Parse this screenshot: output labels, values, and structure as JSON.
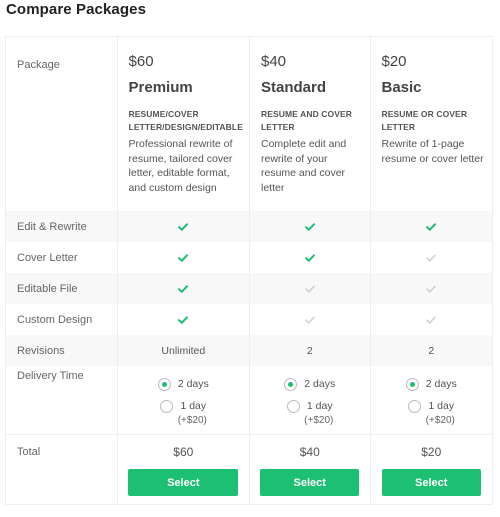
{
  "page": {
    "title": "Compare Packages"
  },
  "colors": {
    "accent": "#1dbf73",
    "check_on": "#1dbf73",
    "check_off": "#d0d0d0",
    "row_alt": "#f8f8f8"
  },
  "header": {
    "row_label": "Package"
  },
  "packages": [
    {
      "price": "$60",
      "name": "Premium",
      "subtitle": "RESUME/COVER LETTER/DESIGN/EDITABLE",
      "description": "Professional rewrite of resume, tailored cover letter, editable format, and custom design",
      "features": [
        true,
        true,
        true,
        true
      ],
      "revisions": "Unlimited",
      "delivery": {
        "selected": "2 days",
        "options": [
          {
            "label": "2 days",
            "selected": true
          },
          {
            "label": "1 day",
            "extra": "(+$20)",
            "selected": false
          }
        ]
      },
      "total": "$60",
      "button": "Select"
    },
    {
      "price": "$40",
      "name": "Standard",
      "subtitle": "RESUME AND COVER LETTER",
      "description": "Complete edit and rewrite of your resume and cover letter",
      "features": [
        true,
        true,
        false,
        false
      ],
      "revisions": "2",
      "delivery": {
        "selected": "2 days",
        "options": [
          {
            "label": "2 days",
            "selected": true
          },
          {
            "label": "1 day",
            "extra": "(+$20)",
            "selected": false
          }
        ]
      },
      "total": "$40",
      "button": "Select"
    },
    {
      "price": "$20",
      "name": "Basic",
      "subtitle": "RESUME OR COVER LETTER",
      "description": "Rewrite of 1-page resume or cover letter",
      "features": [
        true,
        false,
        false,
        false
      ],
      "revisions": "2",
      "delivery": {
        "selected": "2 days",
        "options": [
          {
            "label": "2 days",
            "selected": true
          },
          {
            "label": "1 day",
            "extra": "(+$20)",
            "selected": false
          }
        ]
      },
      "total": "$20",
      "button": "Select"
    }
  ],
  "rows": {
    "features": [
      "Edit & Rewrite",
      "Cover Letter",
      "Editable File",
      "Custom Design"
    ],
    "revisions": "Revisions",
    "delivery": "Delivery Time",
    "total": "Total"
  }
}
